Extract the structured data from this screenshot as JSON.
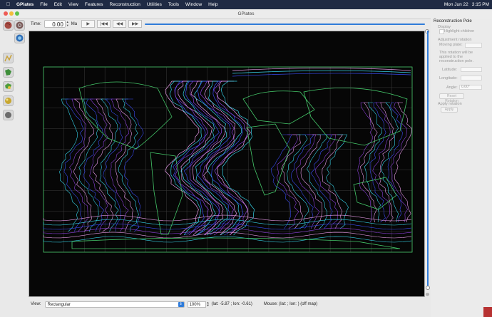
{
  "menubar": {
    "apple_icon": "apple-icon",
    "app": "GPlates",
    "items": [
      "File",
      "Edit",
      "View",
      "Features",
      "Reconstruction",
      "Utilities",
      "Tools",
      "Window",
      "Help"
    ],
    "date": "Mon Jun 22",
    "time": "3:15 PM"
  },
  "window": {
    "title": "GPlates"
  },
  "toolbar": {
    "time_label": "Time:",
    "time_value": "0.00",
    "time_unit": "Ma",
    "buttons": [
      "play-icon",
      "rewind-to-start-icon",
      "step-back-icon",
      "step-forward-icon"
    ],
    "slider_color": "#2f7bd9"
  },
  "tool_palette": [
    "globe-icon",
    "globe-zoom-icon",
    "globe-green-icon",
    "digitise-line-icon",
    "select-feature-icon",
    "move-vertex-icon",
    "rotate-pole-icon",
    "measure-icon"
  ],
  "reconstruction_pole": {
    "title": "Reconstruction Pole",
    "display_label": "Display",
    "highlight_children": "Highlight children",
    "adjustment_rotation": "Adjustment rotation",
    "moving_plate": "Moving plate:",
    "note": [
      "This rotation will be",
      "applied to the",
      "reconstruction pole."
    ],
    "latitude": "Latitude:",
    "longitude": "Longitude:",
    "angle": "Angle:",
    "angle_value": "0.00°",
    "reset_button": "Reset Rotation",
    "apply_label": "Apply rotation",
    "apply_button": "Apply"
  },
  "status": {
    "view_label": "View:",
    "projection": "Rectangular",
    "zoom": "100%",
    "latlon": "(lat: -5.87 ; lon: -0.61)",
    "mouse": "Mouse: (lat: ; lon: ) (off map)"
  },
  "colors": {
    "menubar_bg": "#1f2a44",
    "map_bg": "#060606",
    "graticule": "#3b3b3b",
    "coastline_green": "#45c86a",
    "isochron_pink": "#e79be8",
    "isochron_cyan": "#35d1e6",
    "isochron_blue": "#3a4bf0",
    "isochron_purple": "#8b3fd8"
  }
}
